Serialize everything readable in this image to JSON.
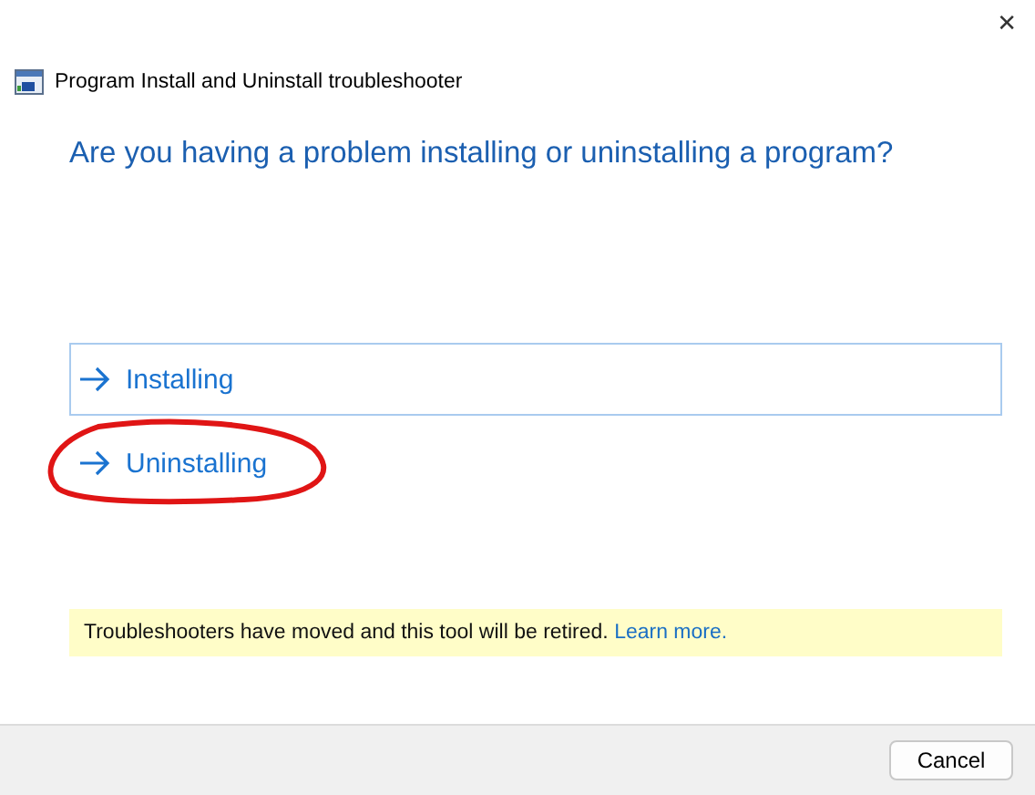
{
  "window": {
    "title": "Program Install and Uninstall troubleshooter",
    "close": "✕"
  },
  "heading": "Are you having a problem installing or uninstalling a program?",
  "options": [
    {
      "label": "Installing",
      "selected": true,
      "circled": false
    },
    {
      "label": "Uninstalling",
      "selected": false,
      "circled": true
    }
  ],
  "notice": {
    "text": "Troubleshooters have moved and this tool will be retired.",
    "link": "Learn more."
  },
  "buttons": [
    "Cancel"
  ]
}
